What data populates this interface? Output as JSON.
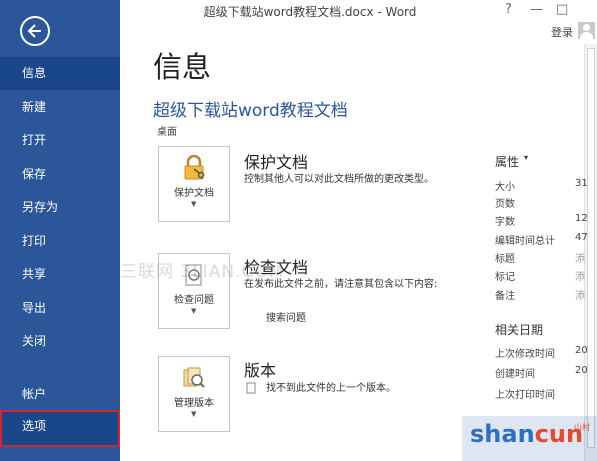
{
  "titlebar": {
    "title": "超级下载站word教程文档.docx - Word",
    "help": "?",
    "minimize": "—",
    "restore": "□",
    "login": "登录"
  },
  "sidebar": {
    "back_icon": "arrow-left-circle-icon",
    "items": [
      {
        "label": "信息",
        "state": "active"
      },
      {
        "label": "新建"
      },
      {
        "label": "打开"
      },
      {
        "label": "保存"
      },
      {
        "label": "另存为"
      },
      {
        "label": "打印"
      },
      {
        "label": "共享"
      },
      {
        "label": "导出"
      },
      {
        "label": "关闭"
      },
      {
        "label": "帐户"
      },
      {
        "label": "选项",
        "state": "selected-highlighted"
      }
    ]
  },
  "main": {
    "page_title": "信息",
    "doc_name": "超级下载站word教程文档",
    "doc_location": "桌面",
    "sections": [
      {
        "button_label": "保护文档",
        "icon": "lock-key-icon",
        "heading": "保护文档",
        "description": "控制其他人可以对此文档所做的更改类型。"
      },
      {
        "button_label": "检查问题",
        "icon": "inspect-document-icon",
        "heading": "检查文档",
        "description": "在发布此文件之前，请注意其包含以下内容:",
        "subitem": "搜索问题"
      },
      {
        "button_label": "管理版本",
        "icon": "manage-versions-icon",
        "heading": "版本",
        "description": "找不到此文件的上一个版本。"
      }
    ]
  },
  "properties": {
    "heading": "属性",
    "rows": [
      {
        "label": "大小",
        "value": "31"
      },
      {
        "label": "页数",
        "value": ""
      },
      {
        "label": "字数",
        "value": "12"
      },
      {
        "label": "编辑时间总计",
        "value": "47"
      },
      {
        "label": "标题",
        "value": "添"
      },
      {
        "label": "标记",
        "value": "添"
      },
      {
        "label": "备注",
        "value": "添"
      }
    ],
    "dates_heading": "相关日期",
    "dates": [
      {
        "label": "上次修改时间",
        "value": "20"
      },
      {
        "label": "创建时间",
        "value": "20"
      },
      {
        "label": "上次打印时间",
        "value": ""
      }
    ]
  },
  "watermarks": {
    "left": "三联网 3LIAN.COM",
    "logo_prefix": "shan",
    "logo_suffix": "cun",
    "logo_small": "山村"
  },
  "colors": {
    "sidebar": "#2b579a",
    "sidebar_active": "#19478a",
    "highlight_border": "#d6262c",
    "doc_name": "#2b579a"
  }
}
